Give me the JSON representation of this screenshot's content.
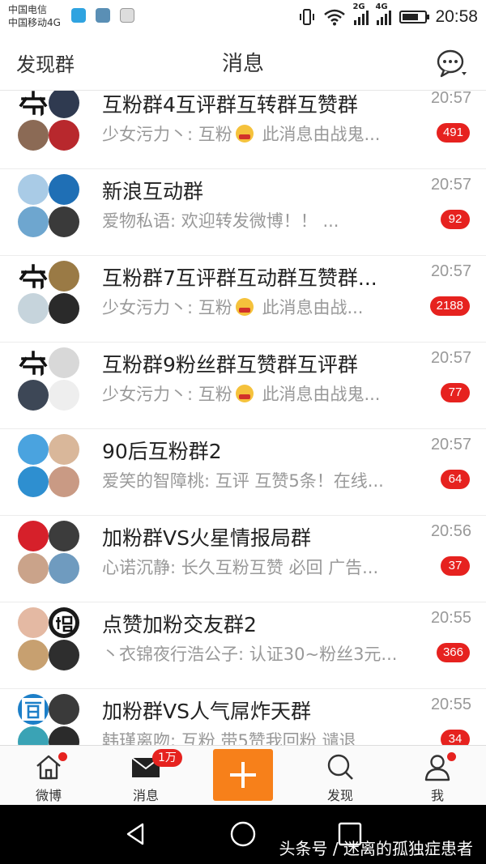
{
  "status_bar": {
    "carrier1": "中国电信",
    "carrier2": "中国移动4G",
    "net1": "2G",
    "net2": "4G",
    "time": "20:58",
    "battery_level": 0.7
  },
  "header": {
    "left_link": "发现群",
    "title": "消息",
    "right_icon": "chat-bubble-icon"
  },
  "conversations": [
    {
      "title": "互粉群4互评群互转群互赞群",
      "time": "20:57",
      "sender": "少女污力丶:",
      "text1": "互粉",
      "has_emoji": true,
      "text2": "此消息由战鬼...",
      "badge": "491",
      "avatars": [
        {
          "kind": "qi",
          "bg": "#ffffff"
        },
        {
          "kind": "photo",
          "bg": "#2f3a50"
        },
        {
          "kind": "photo",
          "bg": "#8b6a55"
        },
        {
          "kind": "photo",
          "bg": "#b8282d"
        }
      ]
    },
    {
      "title": "新浪互动群",
      "time": "20:57",
      "sender": "爱物私语:",
      "text1": "欢迎转发微博！！ ...",
      "has_emoji": false,
      "text2": "",
      "badge": "92",
      "avatars": [
        {
          "kind": "photo",
          "bg": "#a9cbe6"
        },
        {
          "kind": "photo",
          "bg": "#1f6fb5"
        },
        {
          "kind": "photo",
          "bg": "#6ea6cf"
        },
        {
          "kind": "photo",
          "bg": "#3a3a3a"
        }
      ]
    },
    {
      "title": "互粉群7互评群互动群互赞群...",
      "time": "20:57",
      "sender": "少女污力丶:",
      "text1": "互粉",
      "has_emoji": true,
      "text2": "此消息由战...",
      "badge": "2188",
      "avatars": [
        {
          "kind": "qi",
          "bg": "#ffffff"
        },
        {
          "kind": "photo",
          "bg": "#9a7a45"
        },
        {
          "kind": "photo",
          "bg": "#c6d4dc"
        },
        {
          "kind": "photo",
          "bg": "#2a2a2a"
        }
      ]
    },
    {
      "title": "互粉群9粉丝群互赞群互评群",
      "time": "20:57",
      "sender": "少女污力丶:",
      "text1": "互粉",
      "has_emoji": true,
      "text2": "此消息由战鬼...",
      "badge": "77",
      "avatars": [
        {
          "kind": "qi",
          "bg": "#ffffff"
        },
        {
          "kind": "photo",
          "bg": "#d8d8d8"
        },
        {
          "kind": "photo",
          "bg": "#3d4756"
        },
        {
          "kind": "photo",
          "bg": "#eeeeee"
        }
      ]
    },
    {
      "title": "90后互粉群2",
      "time": "20:57",
      "sender": "爱笑的智障桃:",
      "text1": "互评   互赞5条！在线...",
      "has_emoji": false,
      "text2": "",
      "badge": "64",
      "avatars": [
        {
          "kind": "photo",
          "bg": "#4aa3df"
        },
        {
          "kind": "photo",
          "bg": "#d9b79a"
        },
        {
          "kind": "photo",
          "bg": "#2e8fd0"
        },
        {
          "kind": "photo",
          "bg": "#c99a84"
        }
      ]
    },
    {
      "title": "加粉群VS火星情报局群",
      "time": "20:56",
      "sender": "心诺沉静:",
      "text1": "长久互粉互赞  必回   广告...",
      "has_emoji": false,
      "text2": "",
      "badge": "37",
      "avatars": [
        {
          "kind": "photo",
          "bg": "#d6202a"
        },
        {
          "kind": "photo",
          "bg": "#3c3c3c"
        },
        {
          "kind": "photo",
          "bg": "#caa38a"
        },
        {
          "kind": "photo",
          "bg": "#6f9bbf"
        }
      ]
    },
    {
      "title": "点赞加粉交友群2",
      "time": "20:55",
      "sender": "丶衣锦夜行浩公子:",
      "text1": "认证30~粉丝3元...",
      "has_emoji": false,
      "text2": "",
      "badge": "366",
      "avatars": [
        {
          "kind": "photo",
          "bg": "#e4b9a3"
        },
        {
          "kind": "zhao",
          "bg": "#1a1a1a"
        },
        {
          "kind": "photo",
          "bg": "#c7a070"
        },
        {
          "kind": "photo",
          "bg": "#2e2e2e"
        }
      ]
    },
    {
      "title": "加粉群VS人气屌炸天群",
      "time": "20:55",
      "sender": "韩瑾离吻:",
      "text1": "互粉   带5赞我回粉   谴退",
      "has_emoji": false,
      "text2": "",
      "badge": "34",
      "avatars": [
        {
          "kind": "guan",
          "bg": "#1d7fc8"
        },
        {
          "kind": "photo",
          "bg": "#3a3a3a"
        },
        {
          "kind": "photo",
          "bg": "#3aa3b5"
        },
        {
          "kind": "photo",
          "bg": "#2b2b2b"
        }
      ]
    }
  ],
  "tabbar": {
    "home_label": "微博",
    "messages_label": "消息",
    "messages_badge": "1万",
    "discover_label": "发现",
    "me_label": "我"
  },
  "watermark": "头条号 / 迷离的孤独症患者",
  "colors": {
    "accent_orange": "#f7801a",
    "badge_red": "#e6221f",
    "text_primary": "#222222",
    "text_secondary": "#999999"
  }
}
